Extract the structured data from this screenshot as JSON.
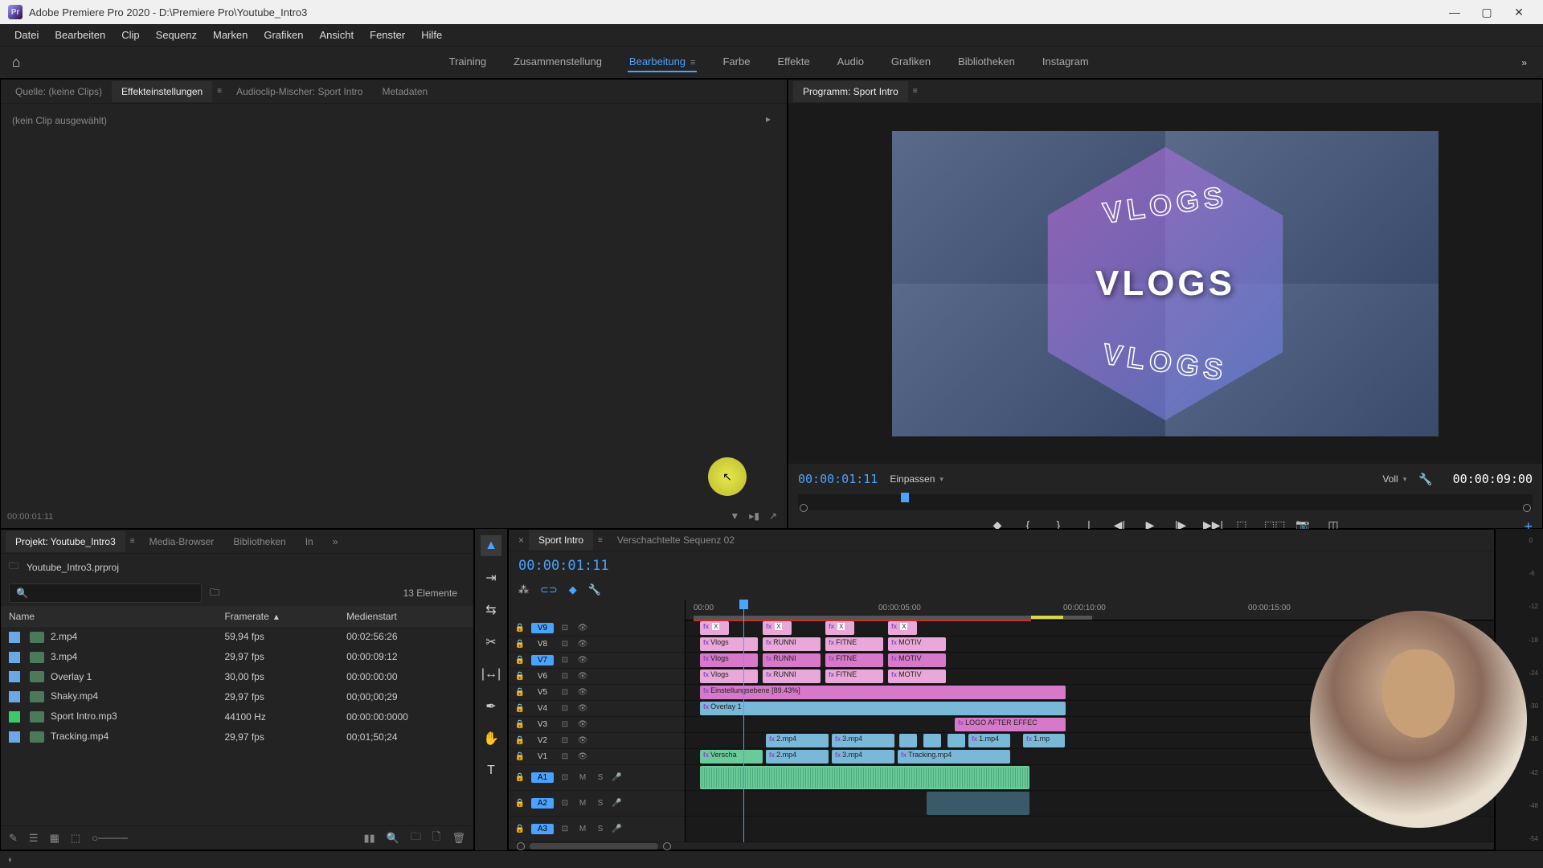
{
  "titlebar": {
    "app_icon": "Pr",
    "title": "Adobe Premiere Pro 2020 - D:\\Premiere Pro\\Youtube_Intro3"
  },
  "menubar": [
    "Datei",
    "Bearbeiten",
    "Clip",
    "Sequenz",
    "Marken",
    "Grafiken",
    "Ansicht",
    "Fenster",
    "Hilfe"
  ],
  "workspaces": {
    "items": [
      "Training",
      "Zusammenstellung",
      "Bearbeitung",
      "Farbe",
      "Effekte",
      "Audio",
      "Grafiken",
      "Bibliotheken",
      "Instagram"
    ],
    "active": "Bearbeitung"
  },
  "source_panel": {
    "tabs": [
      "Quelle: (keine Clips)",
      "Effekteinstellungen",
      "Audioclip-Mischer: Sport Intro",
      "Metadaten"
    ],
    "active_tab": "Effekteinstellungen",
    "no_clip": "(kein Clip ausgewählt)",
    "footer_tc": "00:00:01:11"
  },
  "program_panel": {
    "tab": "Programm: Sport Intro",
    "overlay_main": "VLOGS",
    "overlay_outline": "VLOGS",
    "timecode_left": "00:00:01:11",
    "fit": "Einpassen",
    "quality": "Voll",
    "timecode_right": "00:00:09:00"
  },
  "project_panel": {
    "tabs": [
      "Projekt: Youtube_Intro3",
      "Media-Browser",
      "Bibliotheken",
      "In"
    ],
    "project_file": "Youtube_Intro3.prproj",
    "item_count": "13 Elemente",
    "columns": [
      "Name",
      "Framerate",
      "Medienstart"
    ],
    "rows": [
      {
        "color": "#6aa8e8",
        "name": "2.mp4",
        "framerate": "59,94 fps",
        "start": "00:02:56:26"
      },
      {
        "color": "#6aa8e8",
        "name": "3.mp4",
        "framerate": "29,97 fps",
        "start": "00:00:09:12"
      },
      {
        "color": "#6aa8e8",
        "name": "Overlay 1",
        "framerate": "30,00 fps",
        "start": "00:00:00:00"
      },
      {
        "color": "#6aa8e8",
        "name": "Shaky.mp4",
        "framerate": "29,97 fps",
        "start": "00;00;00;29"
      },
      {
        "color": "#3aca6a",
        "name": "Sport Intro.mp3",
        "framerate": "44100 Hz",
        "start": "00:00:00:0000"
      },
      {
        "color": "#6aa8e8",
        "name": "Tracking.mp4",
        "framerate": "29,97 fps",
        "start": "00;01;50;24"
      }
    ]
  },
  "timeline": {
    "tabs": [
      "Sport Intro",
      "Verschachtelte Sequenz 02"
    ],
    "active_tab": "Sport Intro",
    "timecode": "00:00:01:11",
    "ruler": [
      "00:00",
      "00:00:05:00",
      "00:00:10:00",
      "00:00:15:00"
    ],
    "video_tracks": [
      "V9",
      "V8",
      "V7",
      "V6",
      "V5",
      "V4",
      "V3",
      "V2",
      "V1"
    ],
    "selected_v": [
      "V9",
      "V7"
    ],
    "audio_tracks": [
      "A1",
      "A2",
      "A3"
    ],
    "clips": {
      "v9": [
        {
          "l": "X"
        },
        {
          "l": "X"
        },
        {
          "l": "X"
        },
        {
          "l": "X"
        }
      ],
      "v8": [
        {
          "l": "Vlogs"
        },
        {
          "l": "RUNNI"
        },
        {
          "l": "FITNE"
        },
        {
          "l": "MOTIV"
        }
      ],
      "v7": [
        {
          "l": "Vlogs"
        },
        {
          "l": "RUNNI"
        },
        {
          "l": "FITNE"
        },
        {
          "l": "MOTIV"
        }
      ],
      "v6": [
        {
          "l": "Vlogs"
        },
        {
          "l": "RUNNI"
        },
        {
          "l": "FITNE"
        },
        {
          "l": "MOTIV"
        }
      ],
      "v5_label": "Einstellungsebene [89.43%]",
      "v4_label": "Overlay 1",
      "v3_label": "LOGO AFTER EFFEC",
      "v2": [
        {
          "l": "2.mp4"
        },
        {
          "l": "3.mp4"
        },
        {
          "l": "1.mp4"
        },
        {
          "l": "1.mp"
        }
      ],
      "v1": [
        {
          "l": "Verscha"
        },
        {
          "l": "2.mp4"
        },
        {
          "l": "3.mp4"
        },
        {
          "l": "Tracking.mp4"
        }
      ]
    },
    "ms": {
      "m": "M",
      "s": "S"
    }
  },
  "meter_scale": [
    "0",
    "-6",
    "-12",
    "-18",
    "-24",
    "-30",
    "-36",
    "-42",
    "-48",
    "-54"
  ]
}
